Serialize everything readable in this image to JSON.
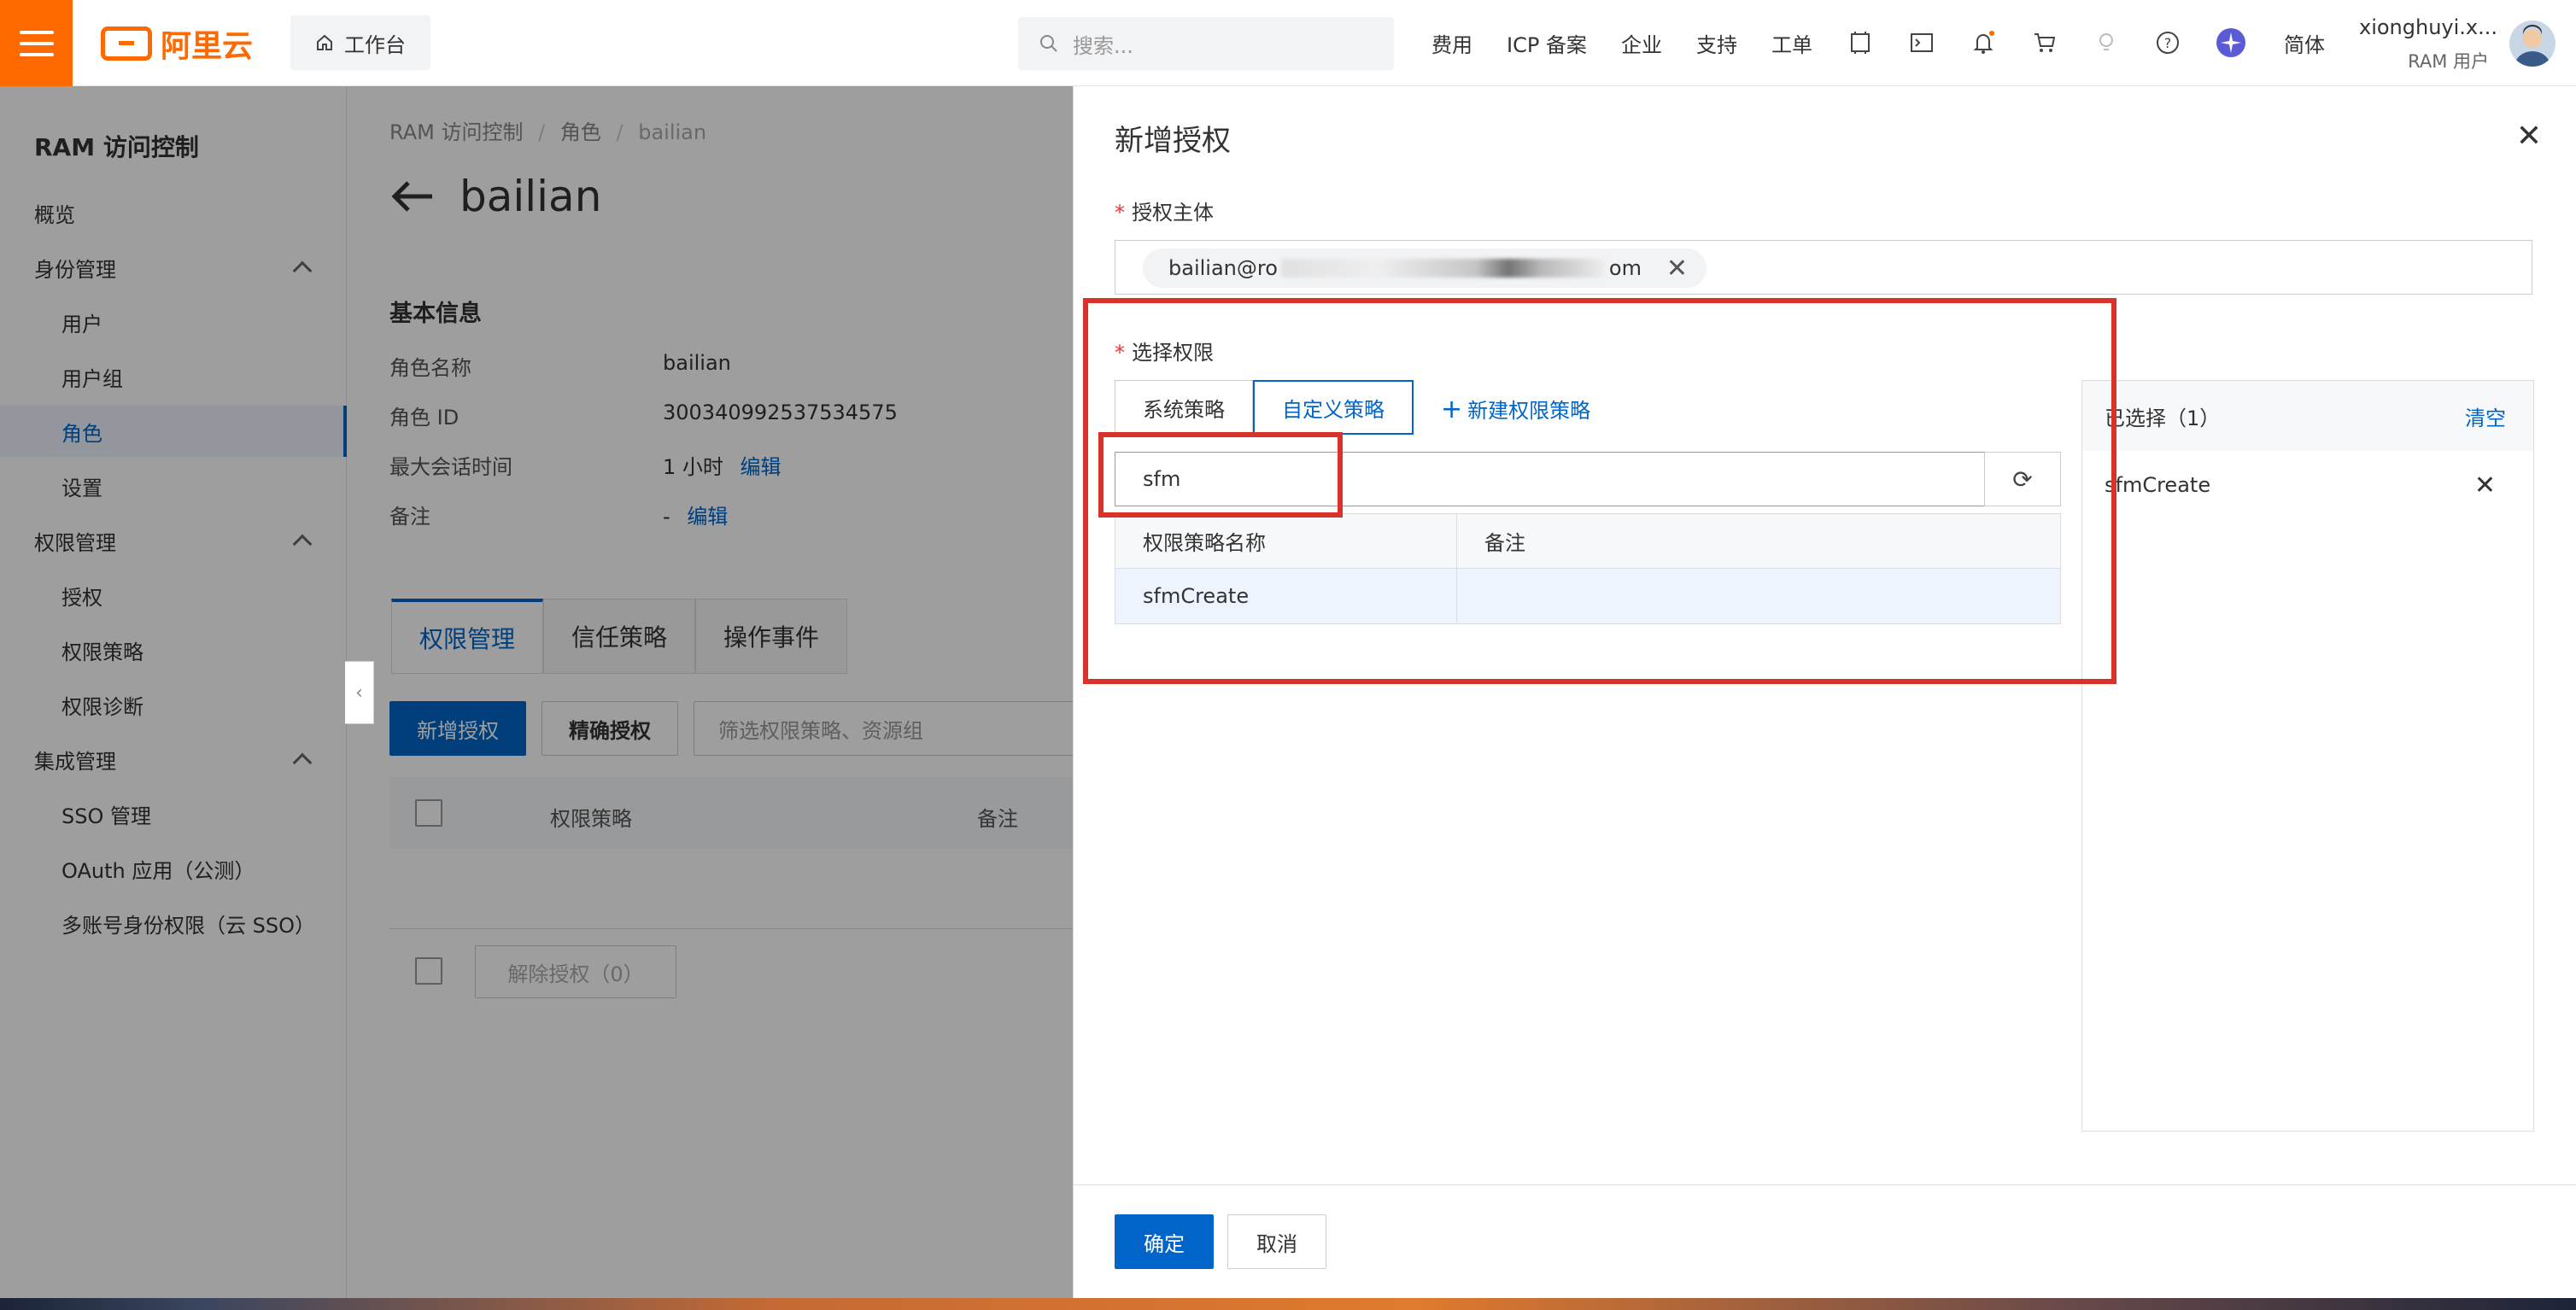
{
  "topbar": {
    "logo_text": "阿里云",
    "workbench_label": "工作台",
    "search_placeholder": "搜索...",
    "nav": [
      "费用",
      "ICP 备案",
      "企业",
      "支持",
      "工单"
    ],
    "lang": "简体",
    "user_name": "xionghuyi.x...",
    "user_role": "RAM 用户",
    "brand_color": "#ff6a00"
  },
  "sidebar": {
    "title": "RAM 访问控制",
    "items": [
      {
        "label": "概览"
      },
      {
        "label": "身份管理"
      },
      {
        "label": "用户"
      },
      {
        "label": "用户组"
      },
      {
        "label": "角色"
      },
      {
        "label": "设置"
      },
      {
        "label": "权限管理"
      },
      {
        "label": "授权"
      },
      {
        "label": "权限策略"
      },
      {
        "label": "权限诊断"
      },
      {
        "label": "集成管理"
      },
      {
        "label": "SSO 管理"
      },
      {
        "label": "OAuth 应用（公测）"
      },
      {
        "label": "多账号身份权限（云 SSO）"
      }
    ]
  },
  "main": {
    "breadcrumb": [
      "RAM 访问控制",
      "/",
      "角色",
      "/",
      "bailian"
    ],
    "title": "bailian",
    "basic_info_title": "基本信息",
    "fields": [
      {
        "key": "角色名称",
        "value": "bailian",
        "action": ""
      },
      {
        "key": "角色 ID",
        "value": "300340992537534575",
        "action": ""
      },
      {
        "key": "最大会话时间",
        "value": "1 小时",
        "action": "编辑"
      },
      {
        "key": "备注",
        "value": "-",
        "action": "编辑"
      }
    ],
    "tabs": [
      "权限管理",
      "信任策略",
      "操作事件"
    ],
    "add_grant_button": "新增授权",
    "precise_grant_button": "精确授权",
    "filter_placeholder": "筛选权限策略、资源组",
    "table_headers": [
      "权限策略",
      "备注"
    ],
    "revoke_button": "解除授权（0）"
  },
  "drawer": {
    "title": "新增授权",
    "principal_label": "授权主体",
    "principal_value_start": "bailian@ro",
    "principal_value_end": "om",
    "permission_label": "选择权限",
    "policy_tabs": [
      "系统策略",
      "自定义策略"
    ],
    "new_policy_link": "新建权限策略",
    "search_value": "sfm",
    "table_headers": [
      "权限策略名称",
      "备注"
    ],
    "rows": [
      {
        "name": "sfmCreate",
        "note": ""
      }
    ],
    "selected_title": "已选择（1）",
    "clear_label": "清空",
    "selected_items": [
      "sfmCreate"
    ],
    "confirm_button": "确定",
    "cancel_button": "取消",
    "accent_color": "#0064c8",
    "highlight_color": "#d8322b"
  }
}
